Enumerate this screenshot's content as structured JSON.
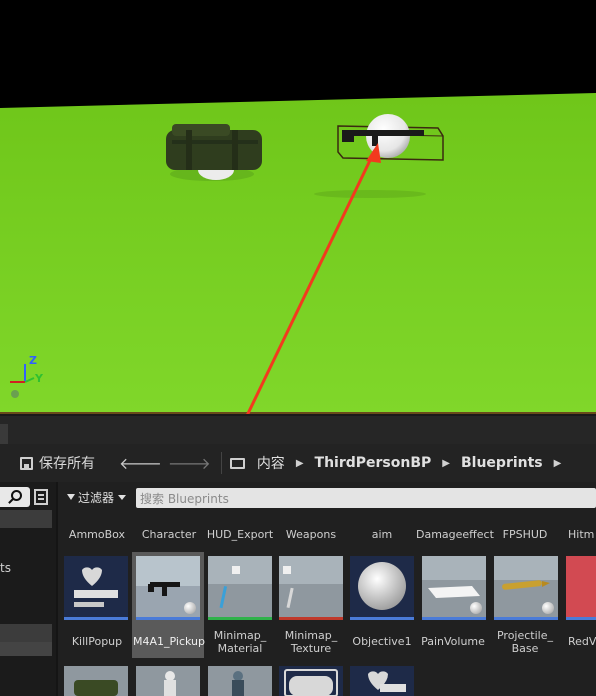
{
  "viewport": {
    "gizmo": {
      "z": "Z",
      "y": "Y"
    },
    "colors": {
      "sky": "#000000",
      "ground": "#7ed321",
      "arrow": "#f23a1e"
    }
  },
  "toolbar": {
    "save_label": "保存所有",
    "breadcrumb": [
      "内容",
      "ThirdPersonBP",
      "Blueprints"
    ]
  },
  "left_panel": {
    "partial_text": "ts"
  },
  "content": {
    "filter_label": "过滤器",
    "search_placeholder": "搜索 Blueprints",
    "folders": [
      "AmmoBox",
      "Character",
      "HUD_Export",
      "Weapons",
      "aim",
      "Damageeffect",
      "FPSHUD",
      "Hitm"
    ],
    "assets": [
      {
        "label": "KillPopup",
        "icon": "heart-widget-icon",
        "line": "#4a7bd8"
      },
      {
        "label": "M4A1_Pickup",
        "icon": "rifle-thumbnail",
        "line": "#4a7bd8",
        "selected": true
      },
      {
        "label": "Minimap_\nMaterial",
        "icon": "material-thumbnail",
        "line": "#2fb24a"
      },
      {
        "label": "Minimap_\nTexture",
        "icon": "texture-thumbnail",
        "line": "#c0392b"
      },
      {
        "label": "Objective1",
        "icon": "sphere-thumbnail",
        "line": "#4a7bd8"
      },
      {
        "label": "PainVolume",
        "icon": "volume-thumbnail",
        "line": "#4a7bd8"
      },
      {
        "label": "Projectile_\nBase",
        "icon": "bullet-thumbnail",
        "line": "#4a7bd8"
      },
      {
        "label": "RedVi",
        "icon": "red-thumbnail",
        "line": "#4a7bd8"
      }
    ]
  }
}
